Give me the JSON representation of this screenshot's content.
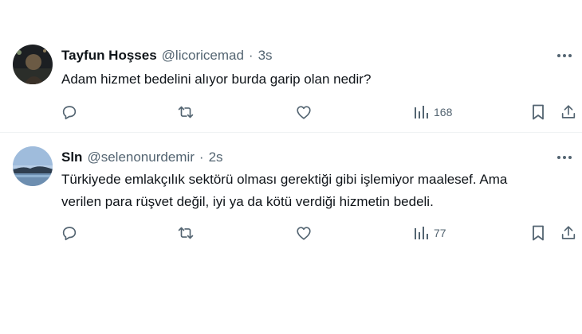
{
  "tweets": [
    {
      "display_name": "Tayfun Hoşses",
      "handle": "@licoricemad",
      "separator": "·",
      "time": "3s",
      "lines": [
        "Adam hizmet bedelini alıyor burda garip olan nedir?"
      ],
      "views": "168"
    },
    {
      "display_name": "Sln",
      "handle": "@selenonurdemir",
      "separator": "·",
      "time": "2s",
      "lines": [
        "Türkiyede emlakçılık sektörü olması gerektiği gibi işlemiyor maalesef. Ama",
        "verilen para rüşvet değil, iyi ya da kötü verdiği hizmetin bedeli."
      ],
      "views": "77"
    }
  ],
  "icons": {
    "reply": "reply-icon",
    "retweet": "retweet-icon",
    "like": "heart-icon",
    "views": "views-chart-icon",
    "bookmark": "bookmark-icon",
    "share": "share-icon",
    "more": "more-dots-icon"
  },
  "colors": {
    "text_primary": "#0f1419",
    "text_secondary": "#536471",
    "divider": "#eff3f4"
  }
}
